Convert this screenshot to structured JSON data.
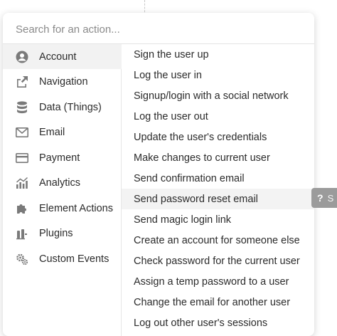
{
  "search": {
    "placeholder": "Search for an action..."
  },
  "categories": [
    {
      "label": "Account",
      "icon": "user-circle-icon"
    },
    {
      "label": "Navigation",
      "icon": "share-out-icon"
    },
    {
      "label": "Data (Things)",
      "icon": "database-icon"
    },
    {
      "label": "Email",
      "icon": "envelope-icon"
    },
    {
      "label": "Payment",
      "icon": "credit-card-icon"
    },
    {
      "label": "Analytics",
      "icon": "chart-icon"
    },
    {
      "label": "Element Actions",
      "icon": "puzzle-icon"
    },
    {
      "label": "Plugins",
      "icon": "plug-icon"
    },
    {
      "label": "Custom Events",
      "icon": "gears-icon"
    }
  ],
  "actions": [
    "Sign the user up",
    "Log the user in",
    "Signup/login with a social network",
    "Log the user out",
    "Update the user's credentials",
    "Make changes to current user",
    "Send confirmation email",
    "Send password reset email",
    "Send magic login link",
    "Create an account for someone else",
    "Check password for the current user",
    "Assign a temp password to a user",
    "Change the email for another user",
    "Log out other user's sessions"
  ],
  "help_tab": {
    "glyph": "?",
    "text": "S"
  },
  "colors": {
    "icon": "#7a7a7a",
    "text": "#2b2b2b",
    "active_bg": "#f2f2f2"
  }
}
